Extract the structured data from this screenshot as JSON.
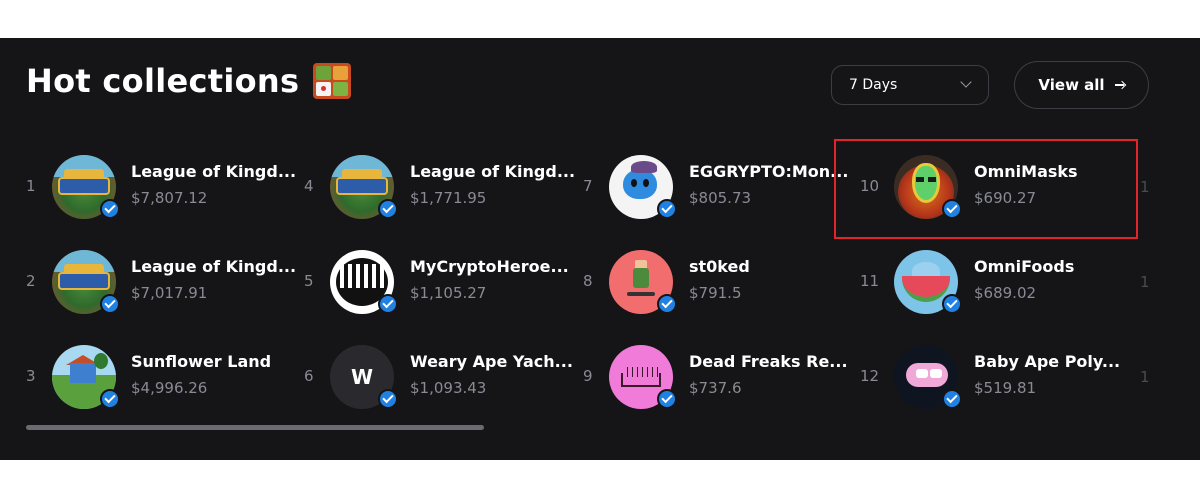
{
  "header": {
    "title": "Hot collections",
    "title_emoji_icon": "bento-box-icon"
  },
  "controls": {
    "timeframe": "7 Days",
    "view_all_label": "View all"
  },
  "collections": [
    {
      "rank": "1",
      "name": "League of Kingd...",
      "price": "$7,807.12",
      "verified": true
    },
    {
      "rank": "2",
      "name": "League of Kingd...",
      "price": "$7,017.91",
      "verified": true
    },
    {
      "rank": "3",
      "name": "Sunflower Land",
      "price": "$4,996.26",
      "verified": true
    },
    {
      "rank": "4",
      "name": "League of Kingd...",
      "price": "$1,771.95",
      "verified": true
    },
    {
      "rank": "5",
      "name": "MyCryptoHeroe...",
      "price": "$1,105.27",
      "verified": true
    },
    {
      "rank": "6",
      "name": "Weary Ape Yach...",
      "price": "$1,093.43",
      "verified": true,
      "avatar_text": "W"
    },
    {
      "rank": "7",
      "name": "EGGRYPTO:Mon...",
      "price": "$805.73",
      "verified": true
    },
    {
      "rank": "8",
      "name": "st0ked",
      "price": "$791.5",
      "verified": true
    },
    {
      "rank": "9",
      "name": "Dead Freaks Re...",
      "price": "$737.6",
      "verified": true
    },
    {
      "rank": "10",
      "name": "OmniMasks",
      "price": "$690.27",
      "verified": true
    },
    {
      "rank": "11",
      "name": "OmniFoods",
      "price": "$689.02",
      "verified": true
    },
    {
      "rank": "12",
      "name": "Baby Ape Poly...",
      "price": "$519.81",
      "verified": true
    }
  ],
  "peek_ranks": [
    "1",
    "1",
    "1"
  ],
  "colors": {
    "panel_bg": "#151518",
    "verified_blue": "#2081e2",
    "highlight_red": "#e0262b",
    "muted_text": "#8a8a94"
  }
}
